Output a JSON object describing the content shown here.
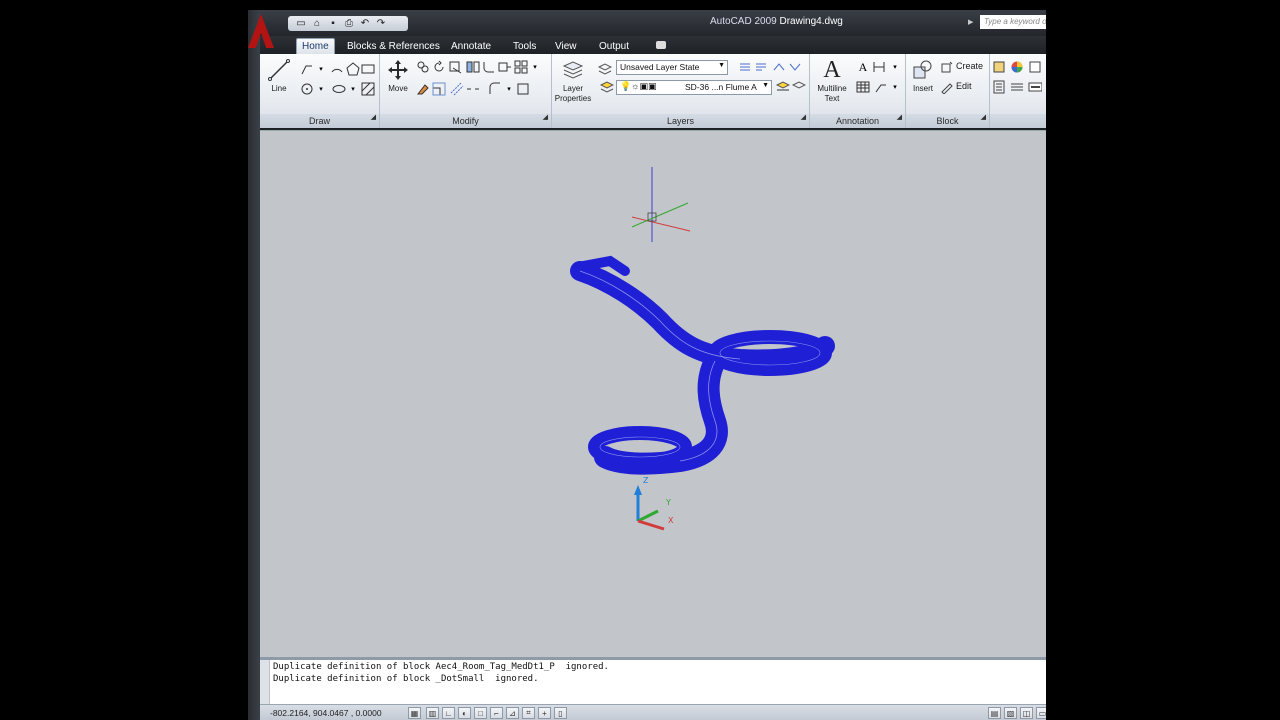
{
  "window": {
    "app_name": "AutoCAD 2009",
    "document": "Drawing4.dwg",
    "search_placeholder": "Type a keyword or phrase"
  },
  "quick_access": {
    "icons": [
      "new-icon",
      "open-icon",
      "save-icon",
      "print-icon",
      "undo-icon",
      "redo-icon"
    ]
  },
  "tabs": [
    {
      "label": "Home",
      "active": true
    },
    {
      "label": "Blocks & References"
    },
    {
      "label": "Annotate"
    },
    {
      "label": "Tools"
    },
    {
      "label": "View"
    },
    {
      "label": "Output"
    }
  ],
  "ribbon": {
    "draw": {
      "title": "Draw",
      "line_label": "Line"
    },
    "modify": {
      "title": "Modify",
      "move_label": "Move"
    },
    "layers": {
      "title": "Layers",
      "layer_properties_label": "Layer\nProperties",
      "layer_state": "Unsaved Layer State",
      "current_layer": "SD-36 ...n Flume A"
    },
    "annotation": {
      "title": "Annotation",
      "mtext_label": "Multiline\nText"
    },
    "block": {
      "title": "Block",
      "insert_label": "Insert",
      "create_label": "Create",
      "edit_label": "Edit"
    }
  },
  "command_history": [
    "Duplicate definition of block Aec4_Room_Tag_MedDt1_P  ignored.",
    "Duplicate definition of block _DotSmall  ignored."
  ],
  "status": {
    "coordinates": "-802.2164, 904.0467 , 0.0000"
  },
  "colors": {
    "model": "#1f1fd6",
    "model_wire": "#b8c2ff",
    "viewport_bg": "#c2c5ca",
    "brand_red": "#b31313"
  }
}
